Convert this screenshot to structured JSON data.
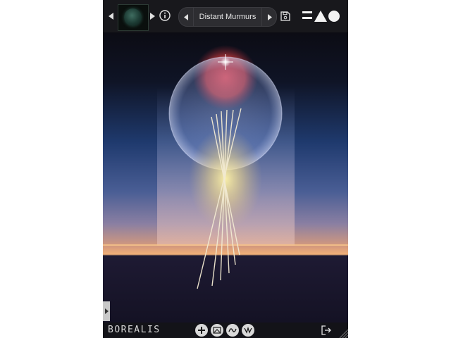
{
  "app": {
    "brand_label": "BOREALIS"
  },
  "header": {
    "thumbnail_prev_icon": "triangle-left-icon",
    "thumbnail_next_icon": "triangle-right-icon",
    "info_icon": "info-icon",
    "preset": {
      "name": "Distant Murmurs"
    },
    "save_icon": "save-icon",
    "logo_icon": "brand-logo-icon"
  },
  "footer": {
    "tools": [
      {
        "icon": "plus-icon"
      },
      {
        "icon": "image-icon"
      },
      {
        "icon": "wave-icon"
      },
      {
        "icon": "double-wave-icon"
      }
    ],
    "exit_icon": "exit-icon"
  },
  "colors": {
    "toolbar": "#18181c",
    "sky_top": "#0c0c14",
    "sky_mid": "#1f3a6e",
    "horizon_glow": "#e8a06a",
    "ground": "#1c1830",
    "sun": "#c03a3a",
    "lines": "#f2ead2"
  }
}
